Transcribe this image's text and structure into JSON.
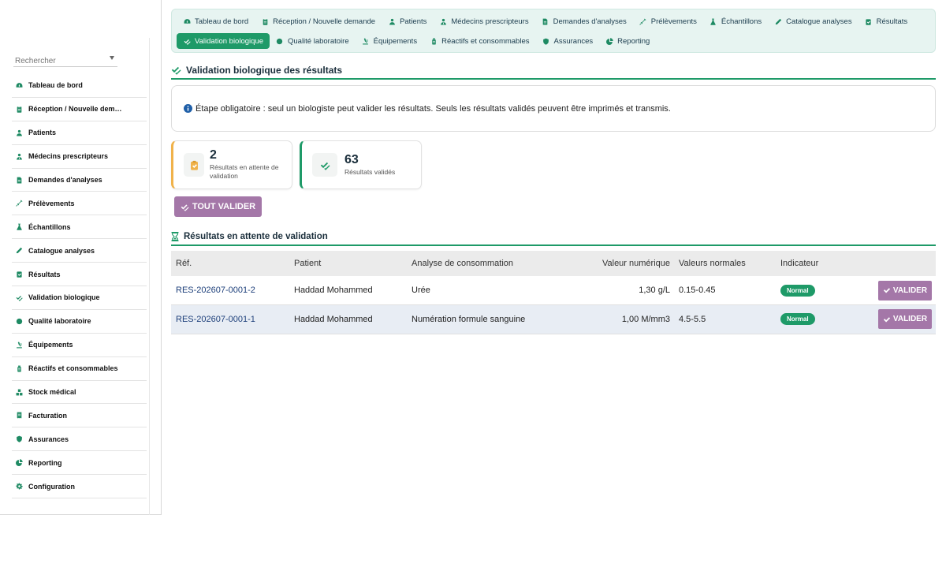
{
  "top_nav": {
    "row1": [
      {
        "label": "Tableau de bord",
        "icon": "dashboard-icon"
      },
      {
        "label": "Réception / Nouvelle demande",
        "icon": "clipboard-icon"
      },
      {
        "label": "Patients",
        "icon": "user-icon"
      },
      {
        "label": "Médecins prescripteurs",
        "icon": "doctor-icon"
      },
      {
        "label": "Demandes d'analyses",
        "icon": "file-icon"
      },
      {
        "label": "Prélèvements",
        "icon": "syringe-icon"
      },
      {
        "label": "Échantillons",
        "icon": "flask-icon"
      },
      {
        "label": "Catalogue analyses",
        "icon": "pencil-icon"
      },
      {
        "label": "Résultats",
        "icon": "clipboard-check-icon"
      }
    ],
    "row2": [
      {
        "label": "Validation biologique",
        "icon": "check-double-icon",
        "active": true
      },
      {
        "label": "Qualité laboratoire",
        "icon": "circle-icon"
      },
      {
        "label": "Équipements",
        "icon": "microscope-icon"
      },
      {
        "label": "Réactifs et consommables",
        "icon": "bottle-icon"
      },
      {
        "label": "Assurances",
        "icon": "shield-icon"
      },
      {
        "label": "Reporting",
        "icon": "pie-chart-icon"
      }
    ]
  },
  "sidebar": {
    "search_placeholder": "Rechercher",
    "items": [
      {
        "label": "Tableau de bord",
        "icon": "dashboard-icon"
      },
      {
        "label": "Réception / Nouvelle dem…",
        "icon": "clipboard-icon"
      },
      {
        "label": "Patients",
        "icon": "user-icon"
      },
      {
        "label": "Médecins prescripteurs",
        "icon": "doctor-icon"
      },
      {
        "label": "Demandes d'analyses",
        "icon": "file-icon"
      },
      {
        "label": "Prélèvements",
        "icon": "syringe-icon"
      },
      {
        "label": "Échantillons",
        "icon": "flask-icon"
      },
      {
        "label": "Catalogue analyses",
        "icon": "pencil-icon"
      },
      {
        "label": "Résultats",
        "icon": "clipboard-check-icon"
      },
      {
        "label": "Validation biologique",
        "icon": "check-double-icon"
      },
      {
        "label": "Qualité laboratoire",
        "icon": "circle-icon"
      },
      {
        "label": "Équipements",
        "icon": "microscope-icon"
      },
      {
        "label": "Réactifs et consommables",
        "icon": "bottle-icon"
      },
      {
        "label": "Stock médical",
        "icon": "boxes-icon"
      },
      {
        "label": "Facturation",
        "icon": "invoice-icon"
      },
      {
        "label": "Assurances",
        "icon": "shield-icon"
      },
      {
        "label": "Reporting",
        "icon": "pie-chart-icon"
      },
      {
        "label": "Configuration",
        "icon": "gear-icon"
      }
    ]
  },
  "page": {
    "title": "Validation biologique des résultats",
    "info": "Étape obligatoire : seul un biologiste peut valider les résultats. Seuls les résultats validés peuvent être imprimés et transmis."
  },
  "stats": {
    "pending": {
      "value": "2",
      "label": "Résultats en attente de validation"
    },
    "validated": {
      "value": "63",
      "label": "Résultats validés"
    }
  },
  "validate_all_label": "TOUT VALIDER",
  "pending_section_title": "Résultats en attente de validation",
  "table": {
    "columns": [
      "Réf.",
      "Patient",
      "Analyse de consommation",
      "Valeur numérique",
      "Valeurs normales",
      "Indicateur"
    ],
    "rows": [
      {
        "ref": "RES-202607-0001-2",
        "patient": "Haddad Mohammed",
        "analyse": "Urée",
        "valeur": "1,30 g/L",
        "normales": "0.15-0.45",
        "indicateur": "Normal",
        "action": "VALIDER"
      },
      {
        "ref": "RES-202607-0001-1",
        "patient": "Haddad Mohammed",
        "analyse": "Numération formule sanguine",
        "valeur": "1,00 M/mm3",
        "normales": "4.5-5.5",
        "indicateur": "Normal",
        "action": "VALIDER"
      }
    ]
  },
  "colors": {
    "accent": "#1e9a68",
    "nav_background": "#e7f4f1",
    "validate_button": "#a477a8",
    "pending_border": "#f0b24a",
    "link": "#1d3f7a"
  }
}
